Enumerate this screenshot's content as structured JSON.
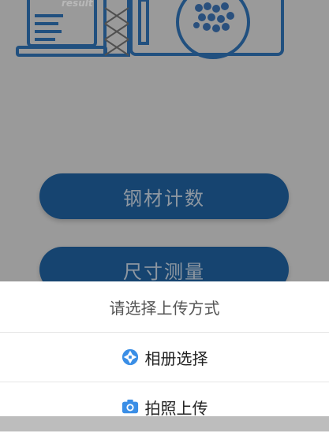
{
  "main": {
    "illustration": {
      "stamp_text": "result"
    },
    "buttons": [
      {
        "label": "钢材计数"
      },
      {
        "label": "尺寸测量"
      }
    ]
  },
  "sheet": {
    "title": "请选择上传方式",
    "options": [
      {
        "label": "相册选择",
        "icon": "aperture-icon"
      },
      {
        "label": "拍照上传",
        "icon": "camera-icon"
      }
    ]
  },
  "colors": {
    "primary": "#1f5f9c",
    "icon_blue": "#3a8ee6",
    "sheet_bg": "#ffffff"
  }
}
